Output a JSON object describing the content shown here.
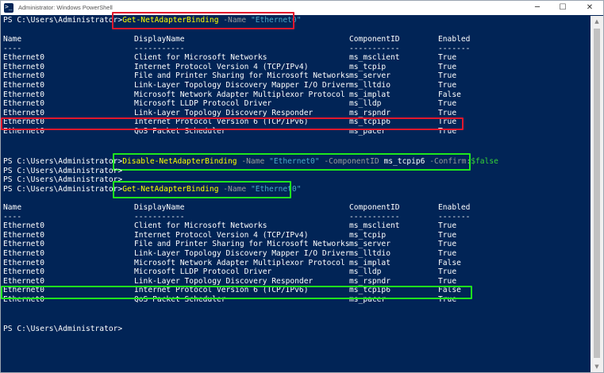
{
  "window": {
    "title": "Administrator: Windows PowerShell",
    "controls": {
      "minimize": "─",
      "maximize": "☐",
      "close": "✕"
    }
  },
  "prompt": "PS C:\\Users\\Administrator>",
  "cmd1": {
    "cmdlet": "Get-NetAdapterBinding",
    "name_param": "-Name",
    "name_value": "\"Ethernet0\""
  },
  "table1": {
    "headers": [
      "Name",
      "DisplayName",
      "ComponentID",
      "Enabled"
    ],
    "underlines": [
      "----",
      "-----------",
      "-----------",
      "-------"
    ],
    "rows": [
      [
        "Ethernet0",
        "Client for Microsoft Networks",
        "ms_msclient",
        "True"
      ],
      [
        "Ethernet0",
        "Internet Protocol Version 4 (TCP/IPv4)",
        "ms_tcpip",
        "True"
      ],
      [
        "Ethernet0",
        "File and Printer Sharing for Microsoft Networks",
        "ms_server",
        "True"
      ],
      [
        "Ethernet0",
        "Link-Layer Topology Discovery Mapper I/O Driver",
        "ms_lltdio",
        "True"
      ],
      [
        "Ethernet0",
        "Microsoft Network Adapter Multiplexor Protocol",
        "ms_implat",
        "False"
      ],
      [
        "Ethernet0",
        "Microsoft LLDP Protocol Driver",
        "ms_lldp",
        "True"
      ],
      [
        "Ethernet0",
        "Link-Layer Topology Discovery Responder",
        "ms_rspndr",
        "True"
      ],
      [
        "Ethernet0",
        "Internet Protocol Version 6 (TCP/IPv6)",
        "ms_tcpip6",
        "True"
      ],
      [
        "Ethernet0",
        "QoS Packet Scheduler",
        "ms_pacer",
        "True"
      ]
    ]
  },
  "cmd2": {
    "cmdlet": "Disable-NetAdapterBinding",
    "name_param": "-Name",
    "name_value": "\"Ethernet0\"",
    "comp_param": "-ComponentID",
    "comp_value": "ms_tcpip6",
    "confirm_param": "-Confirm:",
    "confirm_value": "$false"
  },
  "cmd3": {
    "cmdlet": "Get-NetAdapterBinding",
    "name_param": "-Name",
    "name_value": "\"Ethernet0\""
  },
  "table2": {
    "headers": [
      "Name",
      "DisplayName",
      "ComponentID",
      "Enabled"
    ],
    "underlines": [
      "----",
      "-----------",
      "-----------",
      "-------"
    ],
    "rows": [
      [
        "Ethernet0",
        "Client for Microsoft Networks",
        "ms_msclient",
        "True"
      ],
      [
        "Ethernet0",
        "Internet Protocol Version 4 (TCP/IPv4)",
        "ms_tcpip",
        "True"
      ],
      [
        "Ethernet0",
        "File and Printer Sharing for Microsoft Networks",
        "ms_server",
        "True"
      ],
      [
        "Ethernet0",
        "Link-Layer Topology Discovery Mapper I/O Driver",
        "ms_lltdio",
        "True"
      ],
      [
        "Ethernet0",
        "Microsoft Network Adapter Multiplexor Protocol",
        "ms_implat",
        "False"
      ],
      [
        "Ethernet0",
        "Microsoft LLDP Protocol Driver",
        "ms_lldp",
        "True"
      ],
      [
        "Ethernet0",
        "Link-Layer Topology Discovery Responder",
        "ms_rspndr",
        "True"
      ],
      [
        "Ethernet0",
        "Internet Protocol Version 6 (TCP/IPv6)",
        "ms_tcpip6",
        "False"
      ],
      [
        "Ethernet0",
        "QoS Packet Scheduler",
        "ms_pacer",
        "True"
      ]
    ]
  },
  "colors": {
    "background": "#012456",
    "highlight_red": "#e0182d",
    "highlight_green": "#1ee61e"
  }
}
